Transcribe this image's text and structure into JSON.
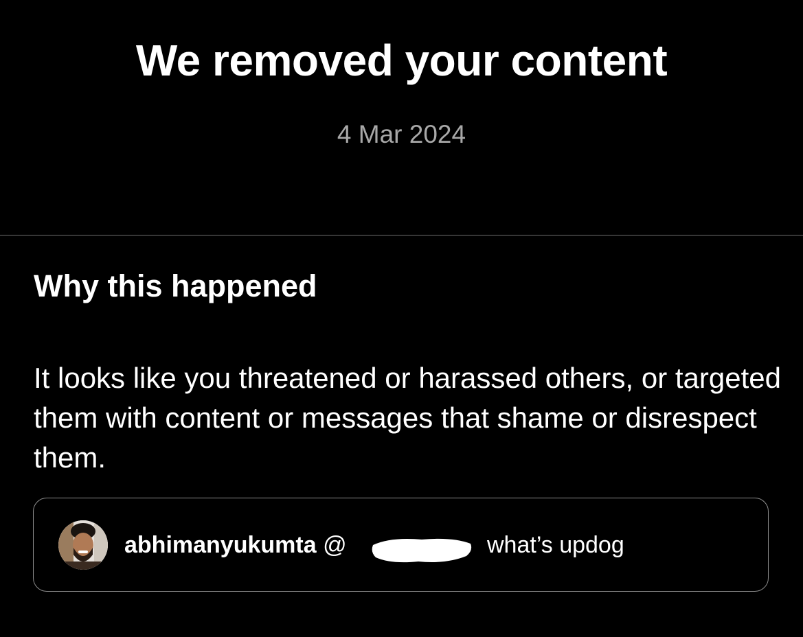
{
  "notice": {
    "title": "We removed your content",
    "date": "4 Mar 2024"
  },
  "why": {
    "heading": "Why this happened",
    "reason": "It looks like you threatened or harassed others, or targeted them with content or messages that shame or disrespect them."
  },
  "content_card": {
    "username": "abhimanyukumta",
    "mention_prefix": "@",
    "comment_text": "what’s updog",
    "avatar_icon": "profile-photo"
  },
  "colors": {
    "background": "#000000",
    "primary_text": "#ffffff",
    "secondary_text": "#a8a8a8",
    "divider": "#363636",
    "card_border": "#8e8e8e"
  }
}
